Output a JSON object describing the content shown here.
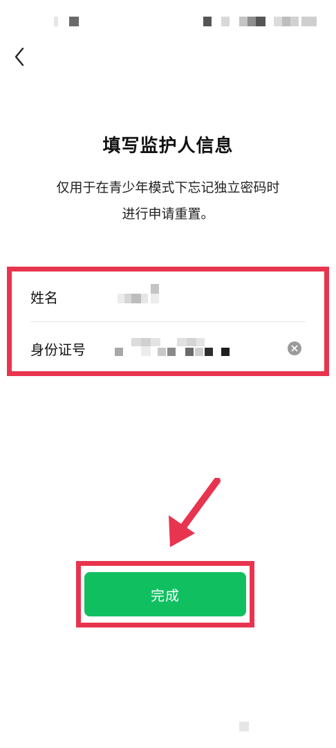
{
  "header": {
    "title": "填写监护人信息",
    "subtitle_line1": "仅用于在青少年模式下忘记独立密码时",
    "subtitle_line2": "进行申请重置。"
  },
  "form": {
    "name_label": "姓名",
    "id_label": "身份证号"
  },
  "actions": {
    "done_label": "完成"
  },
  "colors": {
    "accent": "#10c060",
    "annotation": "#e8344e"
  }
}
